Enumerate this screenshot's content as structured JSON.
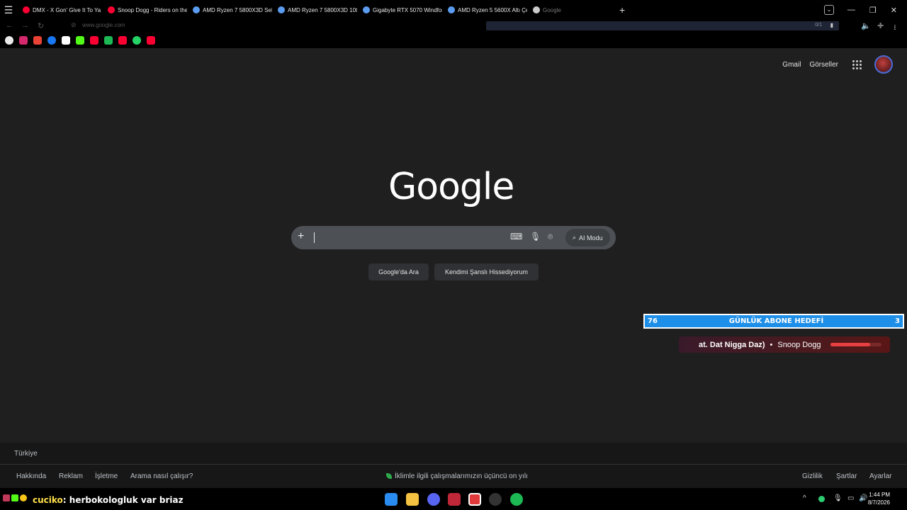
{
  "browser": {
    "tabs": [
      {
        "label": "DMX - X Gon' Give It To Ya |",
        "color": "#ff0033"
      },
      {
        "label": "Snoop Dogg - Riders on the",
        "color": "#ff0033"
      },
      {
        "label": "AMD Ryzen 7 5800X3D Sek",
        "color": "#5b9cf0"
      },
      {
        "label": "AMD Ryzen 7 5800X3D 10t",
        "color": "#5b9cf0"
      },
      {
        "label": "Gigabyte RTX 5070 Windfor",
        "color": "#5b9cf0"
      },
      {
        "label": "AMD Ryzen 5 5600X Altı Çe",
        "color": "#5b9cf0"
      },
      {
        "label": "Google",
        "color": "#cccccc"
      }
    ],
    "new_tab": "+",
    "url": "www.google.com",
    "find_count": "0/1"
  },
  "google": {
    "header": {
      "gmail": "Gmail",
      "images": "Görseller"
    },
    "logo": "Google",
    "search": {
      "plus": "+",
      "ai_mode": "AI Modu"
    },
    "buttons": {
      "search": "Google'da Ara",
      "lucky": "Kendimi Şanslı Hissediyorum"
    },
    "footer": {
      "country": "Türkiye",
      "left": [
        "Hakkında",
        "Reklam",
        "İşletme",
        "Arama nasıl çalışır?"
      ],
      "center": "İklimle ilgili çalışmalarımızın üçüncü on yılı",
      "right": [
        "Gizlilik",
        "Şartlar",
        "Ayarlar"
      ]
    }
  },
  "overlay": {
    "goal_left": "76",
    "goal_title": "GÜNLÜK ABONE HEDEFİ",
    "goal_right": "3",
    "song": "at. Dat Nigga Daz)",
    "separator": "•",
    "artist": "Snoop Dogg",
    "progress": 0.78
  },
  "taskbar": {
    "chat_user": "cuciko",
    "chat_message": ": herbokologluk var briaz",
    "time": "1:44 PM",
    "date": "8/7/2026"
  }
}
